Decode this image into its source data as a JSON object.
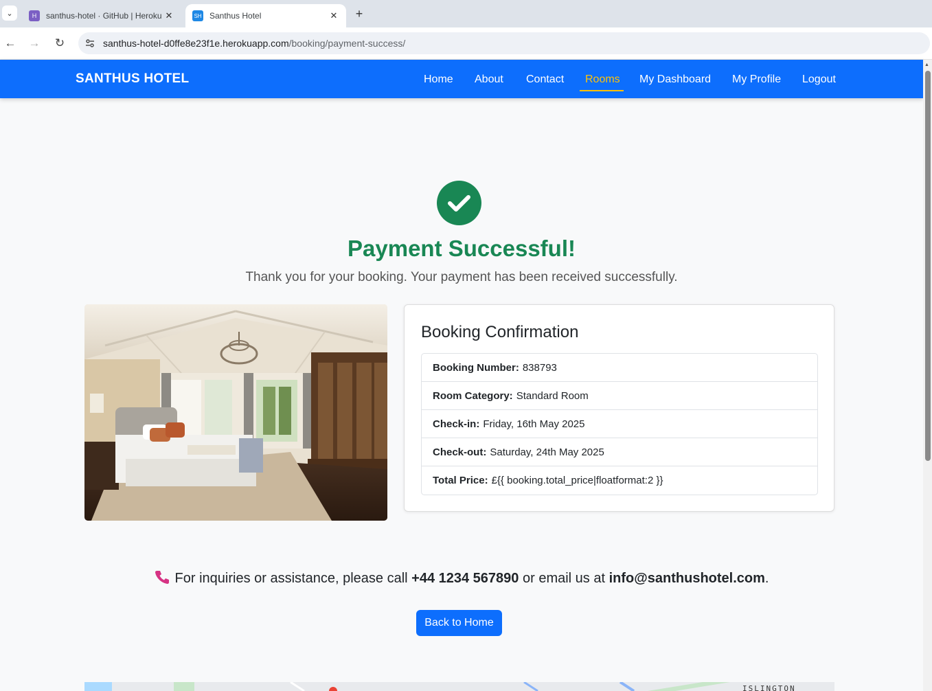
{
  "browser": {
    "tabs": [
      {
        "title": "santhus-hotel · GitHub | Heroku",
        "favicon": "H"
      },
      {
        "title": "Santhus Hotel",
        "favicon": "SH"
      }
    ],
    "url_host": "santhus-hotel-d0ffe8e23f1e.herokuapp.com",
    "url_path": "/booking/payment-success/"
  },
  "navbar": {
    "brand": "SANTHUS HOTEL",
    "links": [
      "Home",
      "About",
      "Contact",
      "Rooms",
      "My Dashboard",
      "My Profile",
      "Logout"
    ],
    "active": "Rooms",
    "color": "#0d6efd",
    "active_color": "#ffc107"
  },
  "success": {
    "title": "Payment Successful!",
    "message": "Thank you for your booking. Your payment has been received successfully.",
    "icon": "check-circle-icon",
    "color": "#198754"
  },
  "booking": {
    "card_title": "Booking Confirmation",
    "fields": [
      {
        "label": "Booking Number:",
        "value": "838793"
      },
      {
        "label": "Room Category:",
        "value": "Standard Room"
      },
      {
        "label": "Check-in:",
        "value": "Friday, 16th May 2025"
      },
      {
        "label": "Check-out:",
        "value": "Saturday, 24th May 2025"
      },
      {
        "label": "Total Price:",
        "value": "£{{ booking.total_price|floatformat:2 }}"
      }
    ]
  },
  "contact": {
    "prefix": "For inquiries or assistance, please call",
    "phone": "+44 1234 567890",
    "middle": "or email us at",
    "email": "info@santhushotel.com",
    "suffix": "."
  },
  "back_button": "Back to Home",
  "map": {
    "label": "ISLINGTON"
  }
}
